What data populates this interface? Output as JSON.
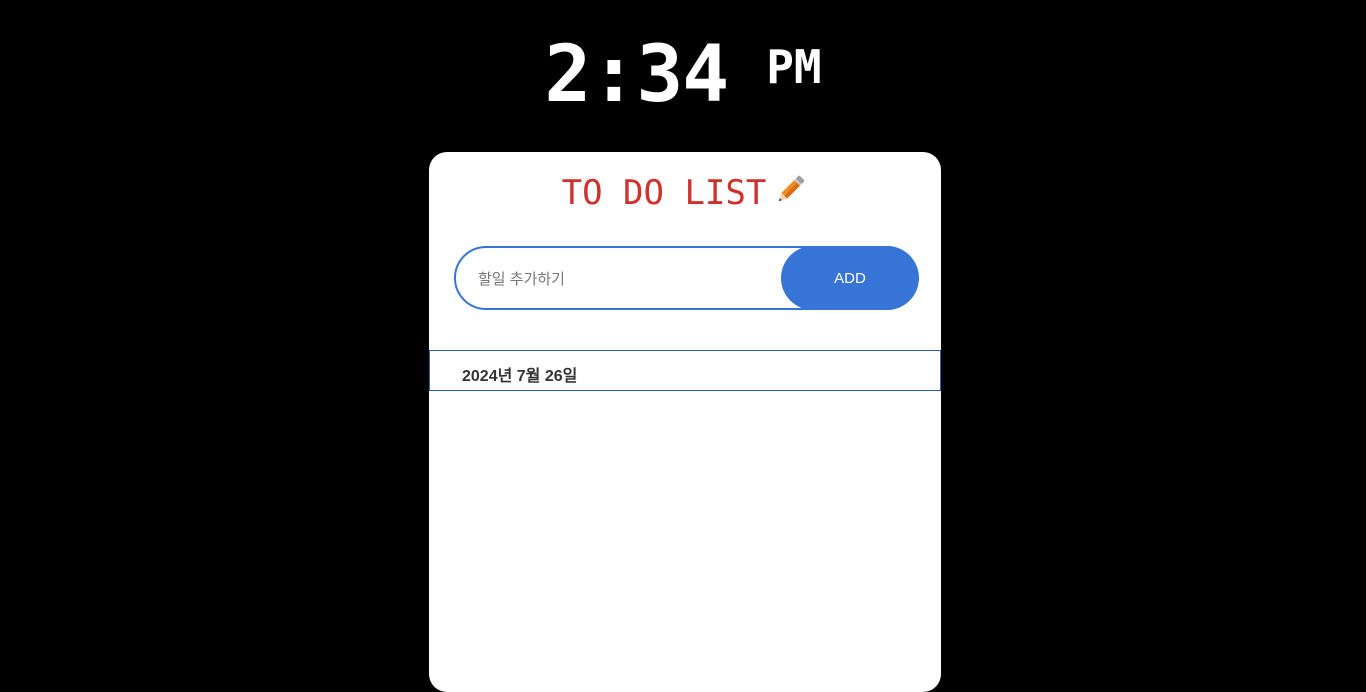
{
  "clock": {
    "hours": "2",
    "minutes": "34",
    "ampm": "PM"
  },
  "card": {
    "title": "TO DO LIST",
    "title_icon": "pencil-icon"
  },
  "input": {
    "value": "",
    "placeholder": "할일 추가하기"
  },
  "add_button": {
    "label": "ADD"
  },
  "date": {
    "label": "2024년 7월 26일"
  },
  "todos": [],
  "colors": {
    "background": "#000000",
    "card": "#ffffff",
    "title": "#d0312d",
    "accent": "#3674d6",
    "date_border": "#2f5fb3",
    "text": "#333333"
  }
}
